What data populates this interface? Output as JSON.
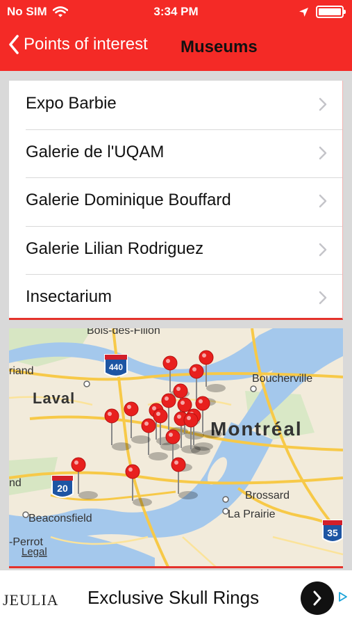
{
  "status_bar": {
    "carrier": "No SIM",
    "time": "3:34 PM"
  },
  "nav": {
    "back_label": "Points of interest",
    "title": "Museums"
  },
  "list": {
    "items": [
      {
        "label": "Expo Barbie"
      },
      {
        "label": "Galerie de l'UQAM"
      },
      {
        "label": "Galerie Dominique Bouffard"
      },
      {
        "label": "Galerie Lilian Rodriguez"
      },
      {
        "label": "Insectarium"
      }
    ]
  },
  "map": {
    "place_labels": {
      "bois_des_filion": "Bois-des-Filion",
      "laval": "Laval",
      "boucherville": "Boucherville",
      "montreal": "Montréal",
      "brossard": "Brossard",
      "beaconsfield": "Beaconsfield",
      "la_prairie": "La Prairie",
      "riand": "riand",
      "nd": "nd",
      "perrot": "-Perrot",
      "legal": "Legal"
    },
    "highway_shields": [
      "440",
      "20",
      "35"
    ],
    "pin_color": "#e8201e"
  },
  "ad": {
    "brand": "JEULIA",
    "text": "Exclusive Skull Rings"
  },
  "colors": {
    "accent": "#f42a26",
    "title_text": "#111111"
  }
}
